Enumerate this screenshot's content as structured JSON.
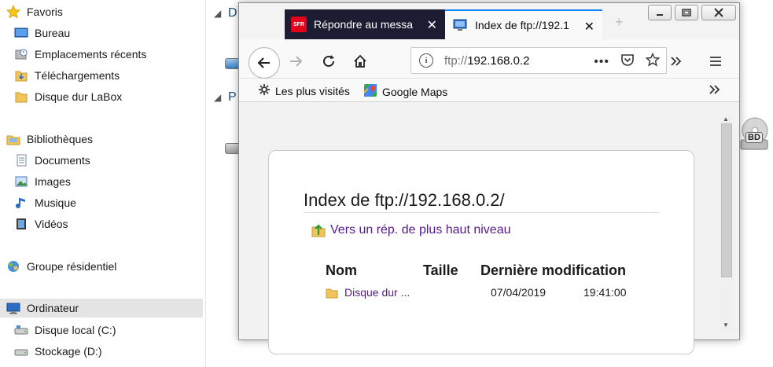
{
  "explorer": {
    "nav": {
      "favorites_label": "Favoris",
      "favorites": [
        "Bureau",
        "Emplacements récents",
        "Téléchargements",
        "Disque dur LaBox"
      ],
      "libraries_label": "Bibliothèques",
      "libraries": [
        "Documents",
        "Images",
        "Musique",
        "Vidéos"
      ],
      "homegroup_label": "Groupe résidentiel",
      "computer_label": "Ordinateur",
      "drives": [
        "Disque local (C:)",
        "Stockage (D:)"
      ]
    },
    "group_letters": [
      "D",
      "P"
    ],
    "bd_label": "BD"
  },
  "firefox": {
    "tabs": [
      {
        "title": "Répondre au messa",
        "favicon": "sfr-logo",
        "favicon_text": "SFR",
        "active": false
      },
      {
        "title": "Index de ftp://192.1",
        "favicon": "monitor-icon",
        "active": true
      }
    ],
    "close_glyph": "✕",
    "url": {
      "scheme": "ftp://",
      "host": "192.168.0.2"
    },
    "page_actions": "•••",
    "bookmarks": [
      "Les plus visités",
      "Google Maps"
    ],
    "overflow": "»",
    "accent_color": "#0a84ff"
  },
  "page": {
    "title": "Index de ftp://192.168.0.2/",
    "up_link": "Vers un rép. de plus haut niveau",
    "columns": [
      "Nom",
      "Taille",
      "Dernière modification"
    ],
    "rows": [
      {
        "name": "Disque dur ...",
        "size": "",
        "date": "07/04/2019",
        "time": "19:41:00"
      }
    ],
    "link_color": "#551a8b"
  }
}
